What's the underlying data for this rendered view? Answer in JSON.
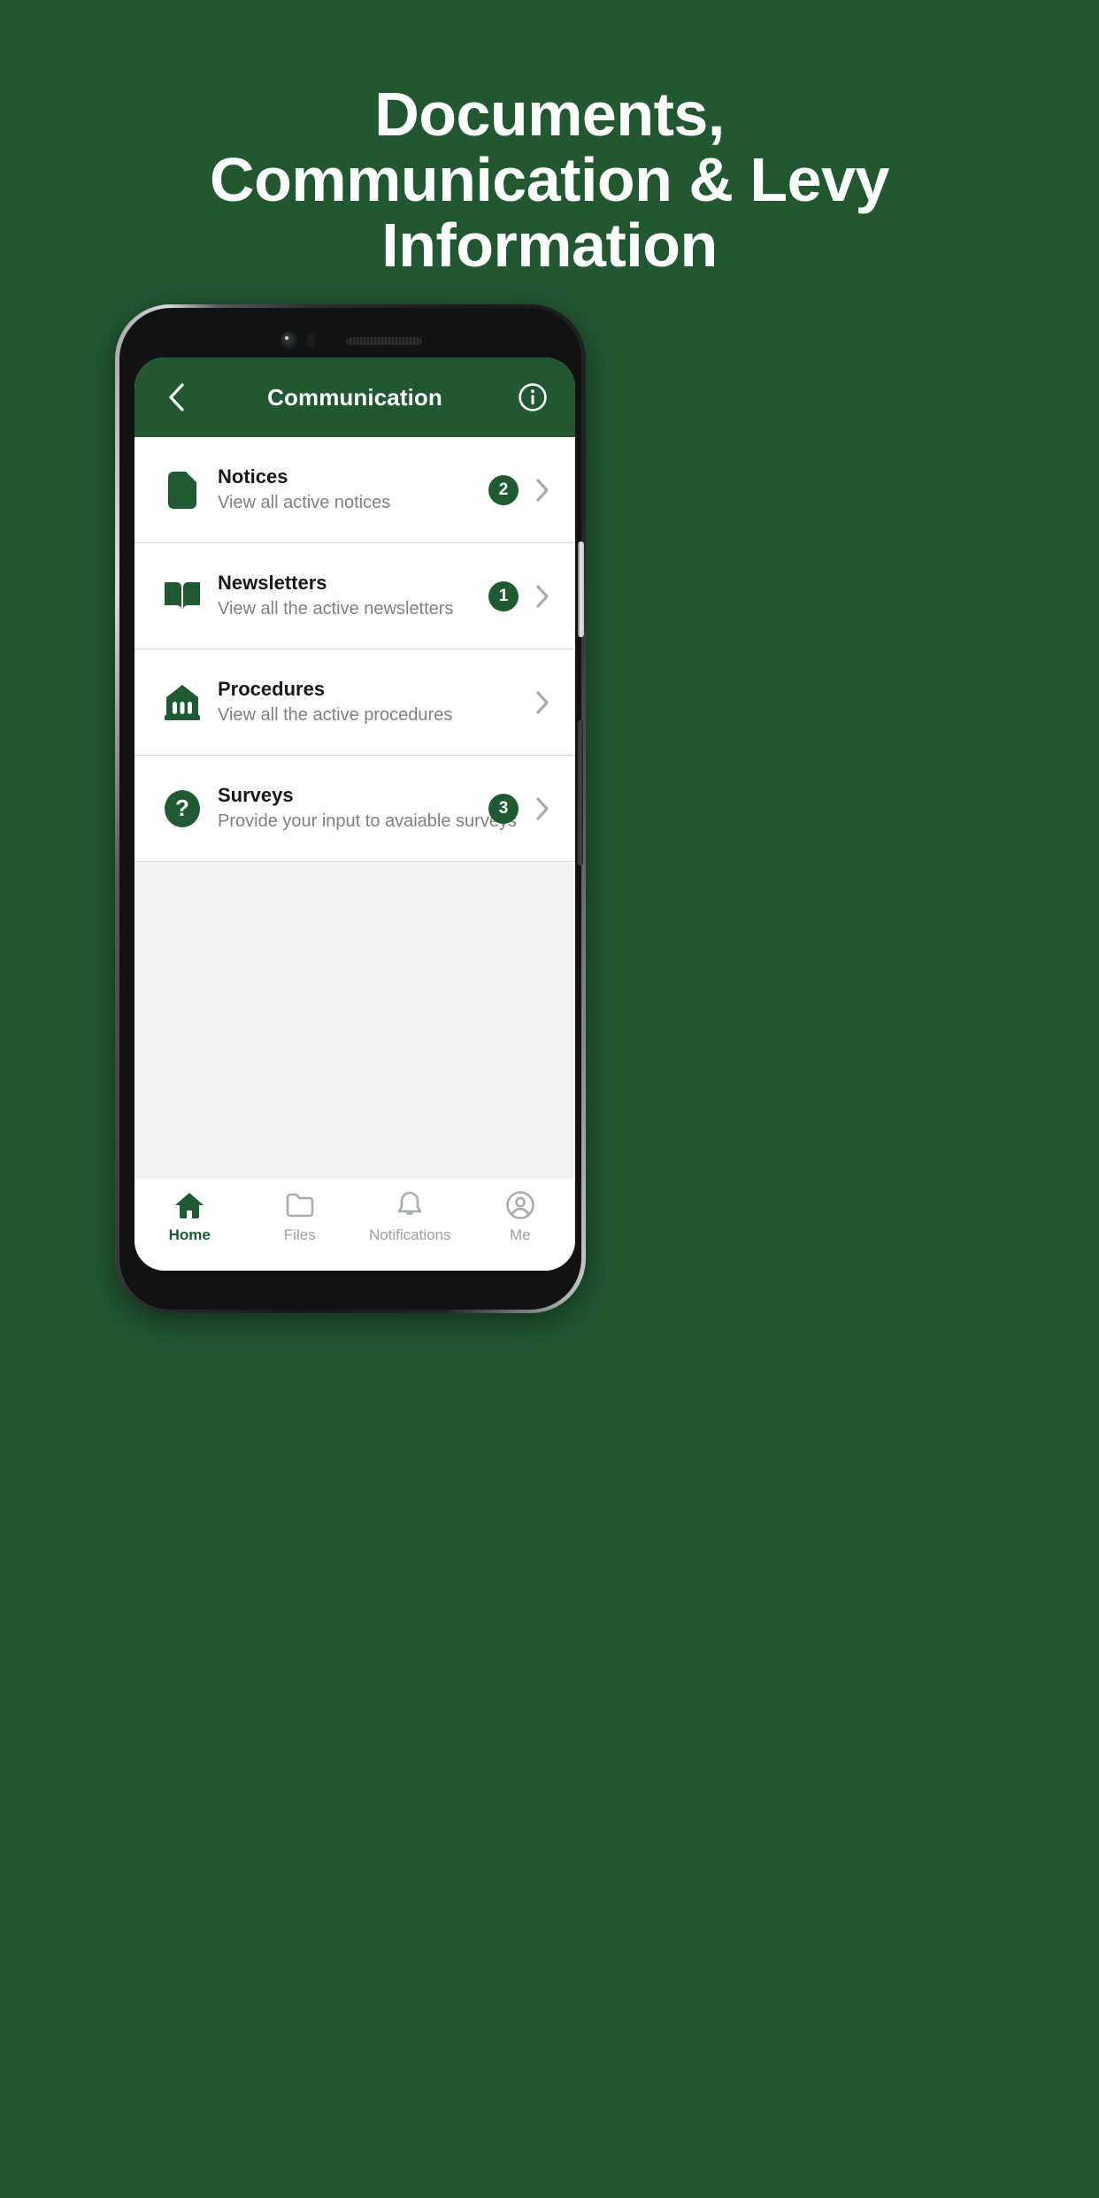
{
  "promo": {
    "headline_lines": [
      "Documents,",
      "Communication & Levy",
      "Information"
    ],
    "background_color": "#215832"
  },
  "app": {
    "brand_color": "#1f5a33",
    "header": {
      "title": "Communication",
      "back_icon": "chevron-left-icon",
      "info_icon": "info-circle-icon"
    },
    "list": [
      {
        "icon": "notice-document-icon",
        "title": "Notices",
        "subtitle": "View all active notices",
        "badge": "2",
        "chevron_icon": "chevron-right-icon"
      },
      {
        "icon": "open-book-icon",
        "title": "Newsletters",
        "subtitle": "View all the active newsletters",
        "badge": "1",
        "chevron_icon": "chevron-right-icon"
      },
      {
        "icon": "bank-building-icon",
        "title": "Procedures",
        "subtitle": "View all the active procedures",
        "badge": "",
        "chevron_icon": "chevron-right-icon"
      },
      {
        "icon": "question-mark-circle-icon",
        "title": "Surveys",
        "subtitle": "Provide your input to avaiable surveys",
        "badge": "3",
        "chevron_icon": "chevron-right-icon"
      }
    ],
    "tabbar": [
      {
        "label": "Home",
        "icon": "home-icon",
        "active": true
      },
      {
        "label": "Files",
        "icon": "folder-icon",
        "active": false
      },
      {
        "label": "Notifications",
        "icon": "bell-icon",
        "active": false
      },
      {
        "label": "Me",
        "icon": "person-circle-icon",
        "active": false
      }
    ]
  }
}
